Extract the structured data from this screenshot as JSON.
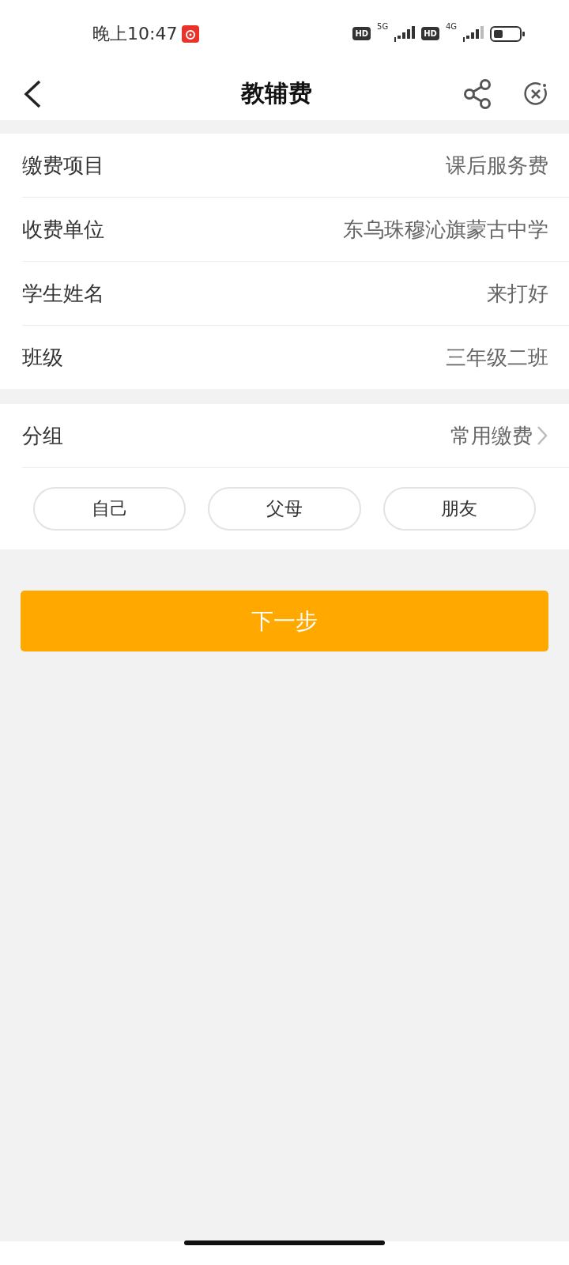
{
  "status_bar": {
    "time": "晚上10:47",
    "sims": [
      {
        "badge": "HD",
        "network": "5G"
      },
      {
        "badge": "HD",
        "network": "4G"
      }
    ]
  },
  "header": {
    "title": "教辅费"
  },
  "info_rows": [
    {
      "label": "缴费项目",
      "value": "课后服务费"
    },
    {
      "label": "收费单位",
      "value": "东乌珠穆沁旗蒙古中学"
    },
    {
      "label": "学生姓名",
      "value": "来打好"
    },
    {
      "label": "班级",
      "value": "三年级二班"
    }
  ],
  "group": {
    "label": "分组",
    "value": "常用缴费",
    "options": [
      {
        "label": "自己",
        "selected": false
      },
      {
        "label": "父母",
        "selected": false
      },
      {
        "label": "朋友",
        "selected": false
      }
    ]
  },
  "next_button": {
    "label": "下一步"
  }
}
